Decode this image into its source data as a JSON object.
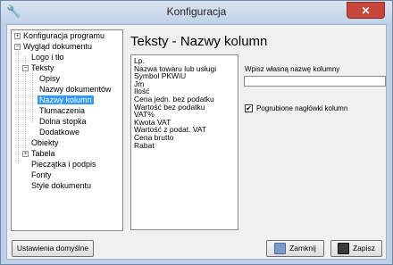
{
  "window": {
    "title": "Konfiguracja",
    "close_glyph": "✕",
    "app_icon": "wrench-icon"
  },
  "tree": {
    "items": [
      {
        "label": "Konfiguracja programu",
        "expander": "+"
      },
      {
        "label": "Wygląd dokumentu",
        "expander": "−"
      },
      {
        "label": "Logo i tło"
      },
      {
        "label": "Teksty",
        "expander": "−"
      },
      {
        "label": "Opisy"
      },
      {
        "label": "Nazwy dokumentów"
      },
      {
        "label": "Nazwy kolumn",
        "selected": true
      },
      {
        "label": "Tłumaczenia"
      },
      {
        "label": "Dolna stopka"
      },
      {
        "label": "Dodatkowe"
      },
      {
        "label": "Obiekty"
      },
      {
        "label": "Tabela",
        "expander": "+"
      },
      {
        "label": "Pieczątka i podpis"
      },
      {
        "label": "Fonty"
      },
      {
        "label": "Style dokumentu"
      }
    ]
  },
  "main": {
    "title": "Teksty - Nazwy kolumn",
    "columns": [
      "Lp.",
      "Nazwa towaru lub usługi",
      "Symbol PKWiU",
      "Jm",
      "Ilość",
      "Cena jedn. bez podatku",
      "Wartość bez podatku",
      "VAT%",
      "Kwota VAT",
      "Wartość z podat. VAT",
      "Cena brutto",
      "Rabat"
    ],
    "custom_name_label": "Wpisz własną nazwę kolumny",
    "custom_name_value": "",
    "bold_headers_label": "Pogrubione nagłówki kolumn",
    "bold_headers_checked": true,
    "check_glyph": "✔"
  },
  "buttons": {
    "defaults": "Ustawienia domyślne",
    "close": "Zamknij",
    "save": "Zapisz"
  },
  "colors": {
    "selection": "#3399ff",
    "close_button": "#c7463b"
  }
}
